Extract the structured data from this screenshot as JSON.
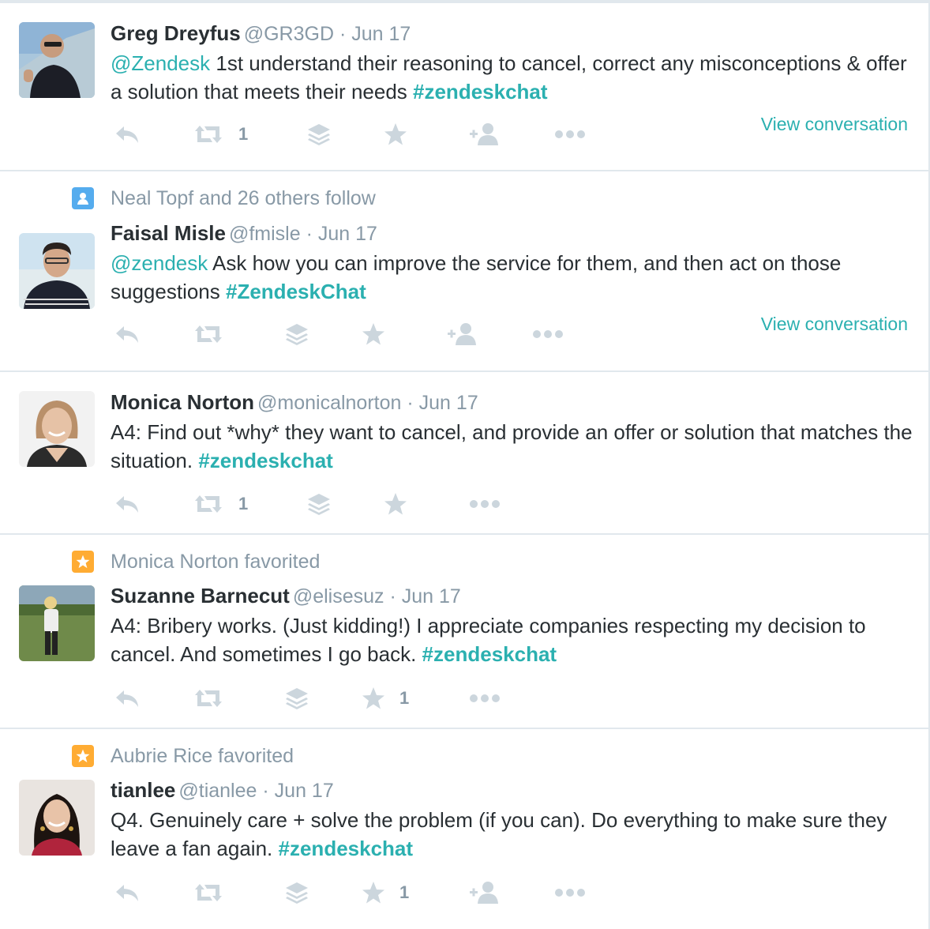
{
  "colors": {
    "link": "#2bb0b0",
    "muted": "#8899a6",
    "text": "#292f33",
    "follow_badge": "#55acee",
    "favorite_badge": "#ffac33"
  },
  "tweets": [
    {
      "name": "Greg Dreyfus",
      "handle": "@GR3GD",
      "sep": "·",
      "date": "Jun 17",
      "mention": "@Zendesk",
      "text": "1st understand their reasoning to cancel, correct any misconceptions & offer a solution that meets their needs",
      "hashtag": "#zendeskchat",
      "retweets": "1",
      "view_conversation": "View conversation",
      "avatar_icon": "person-photo"
    },
    {
      "context": "Neal Topf and 26 others follow",
      "context_icon": "person-icon",
      "name": "Faisal Misle",
      "handle": "@fmisle",
      "sep": "·",
      "date": "Jun 17",
      "mention": "@zendesk",
      "text": "Ask how you can improve the service for them, and then act on those suggestions",
      "hashtag": "#ZendeskChat",
      "view_conversation": "View conversation",
      "avatar_icon": "person-photo"
    },
    {
      "name": "Monica Norton",
      "handle": "@monicalnorton",
      "sep": "·",
      "date": "Jun 17",
      "text": "A4: Find out *why* they want to cancel, and provide an offer or solution that matches the situation.",
      "hashtag": "#zendeskchat",
      "retweets": "1",
      "avatar_icon": "person-photo"
    },
    {
      "context": "Monica Norton favorited",
      "context_icon": "star-icon",
      "name": "Suzanne Barnecut",
      "handle": "@elisesuz",
      "sep": "·",
      "date": "Jun 17",
      "text": "A4: Bribery works. (Just kidding!) I appreciate companies respecting my decision to cancel. And sometimes I go back.",
      "hashtag": "#zendeskchat",
      "favorites": "1",
      "avatar_icon": "person-photo"
    },
    {
      "context": "Aubrie Rice favorited",
      "context_icon": "star-icon",
      "name": "tianlee",
      "handle": "@tianlee",
      "sep": "·",
      "date": "Jun 17",
      "text": "Q4. Genuinely care + solve the problem (if you can). Do everything to make sure they leave a fan again.",
      "hashtag": "#zendeskchat",
      "favorites": "1",
      "avatar_icon": "person-photo"
    }
  ]
}
